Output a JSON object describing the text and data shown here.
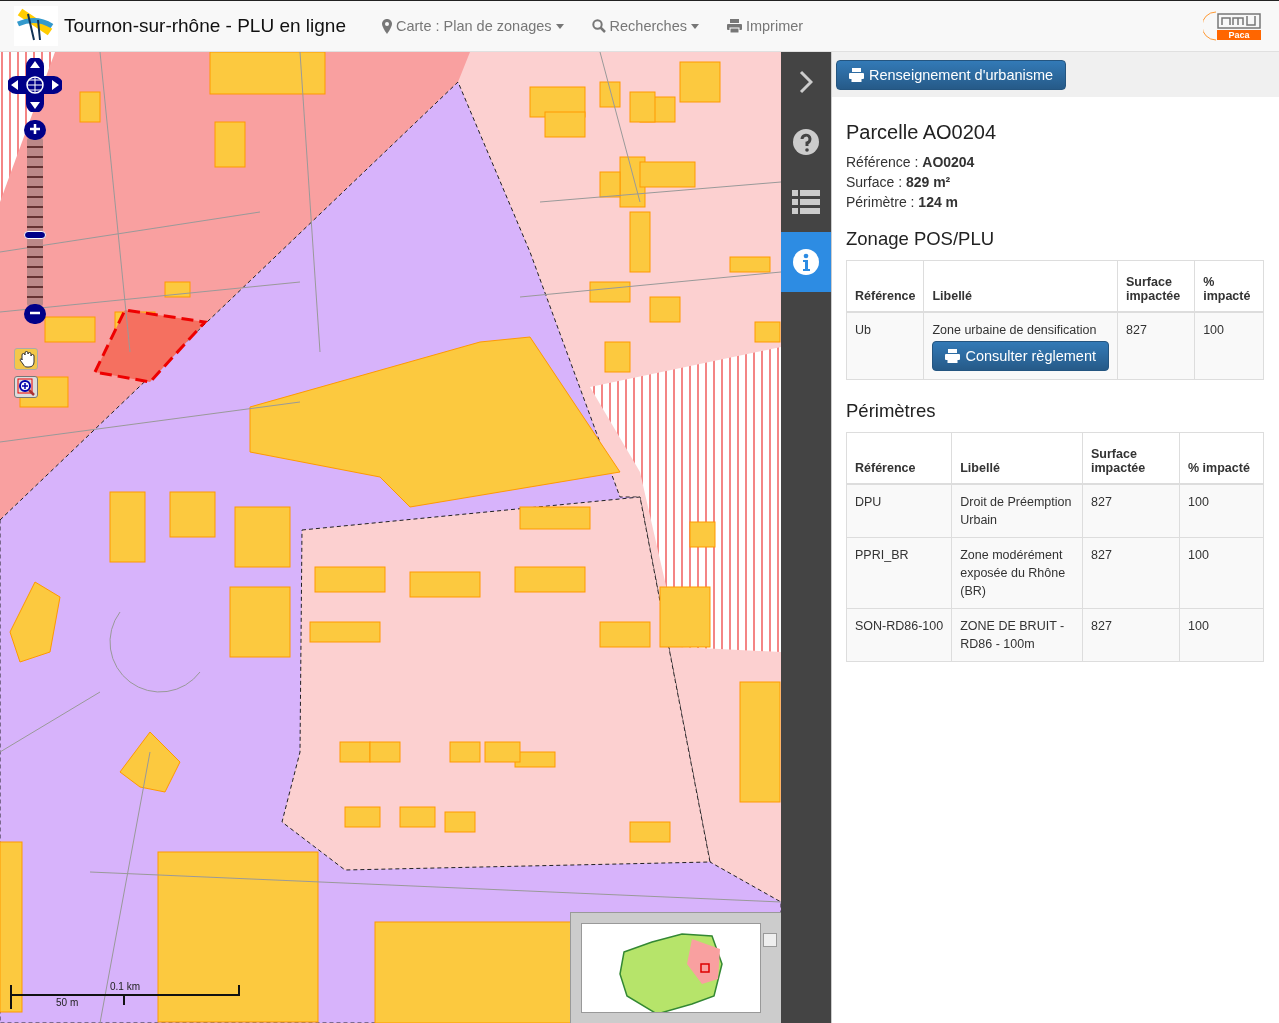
{
  "header": {
    "title": "Tournon-sur-rhône - PLU en ligne",
    "menus": [
      {
        "kind": "dropdown",
        "label": "Carte : Plan de zonages"
      },
      {
        "kind": "dropdown",
        "label": "Recherches"
      },
      {
        "kind": "link",
        "label": "Imprimer"
      }
    ],
    "partner_logo": {
      "label": "Paca"
    }
  },
  "map": {
    "zoom": {
      "level": 0.42
    },
    "tools": [
      {
        "kind": "pan",
        "selected": false
      },
      {
        "kind": "zoombox",
        "selected": true
      }
    ],
    "scale": {
      "top_label": "0.1 km",
      "bottom_label": "50 m"
    }
  },
  "side_tabs": [
    {
      "kind": "collapse",
      "selected": false
    },
    {
      "kind": "help",
      "selected": false
    },
    {
      "kind": "list",
      "selected": false
    },
    {
      "kind": "info",
      "selected": true
    }
  ],
  "panel": {
    "action_button": "Renseignement d'urbanisme",
    "title": "Parcelle AO0204",
    "facts": [
      {
        "label": "Référence : ",
        "value": "AO0204"
      },
      {
        "label": "Surface : ",
        "value": "829 m²"
      },
      {
        "label": "Périmètre : ",
        "value": "124 m"
      }
    ],
    "sections": [
      {
        "title": "Zonage POS/PLU",
        "columns": [
          "Référence",
          "Libellé",
          "Surface impactée",
          "% impacté"
        ],
        "rows": [
          {
            "cells": [
              "Ub",
              "Zone urbaine de densification",
              "827",
              "100"
            ],
            "button": "Consulter règlement"
          }
        ]
      },
      {
        "title": "Périmètres",
        "columns": [
          "Référence",
          "Libellé",
          "Surface impactée",
          "% impacté"
        ],
        "rows": [
          {
            "cells": [
              "DPU",
              "Droit de Préemption Urbain",
              "827",
              "100"
            ]
          },
          {
            "cells": [
              "PPRI_BR",
              "Zone modérément exposée du Rhône (BR)",
              "827",
              "100"
            ]
          },
          {
            "cells": [
              "SON-RD86-100",
              "ZONE DE BRUIT - RD86 - 100m",
              "827",
              "100"
            ]
          }
        ]
      }
    ]
  }
}
